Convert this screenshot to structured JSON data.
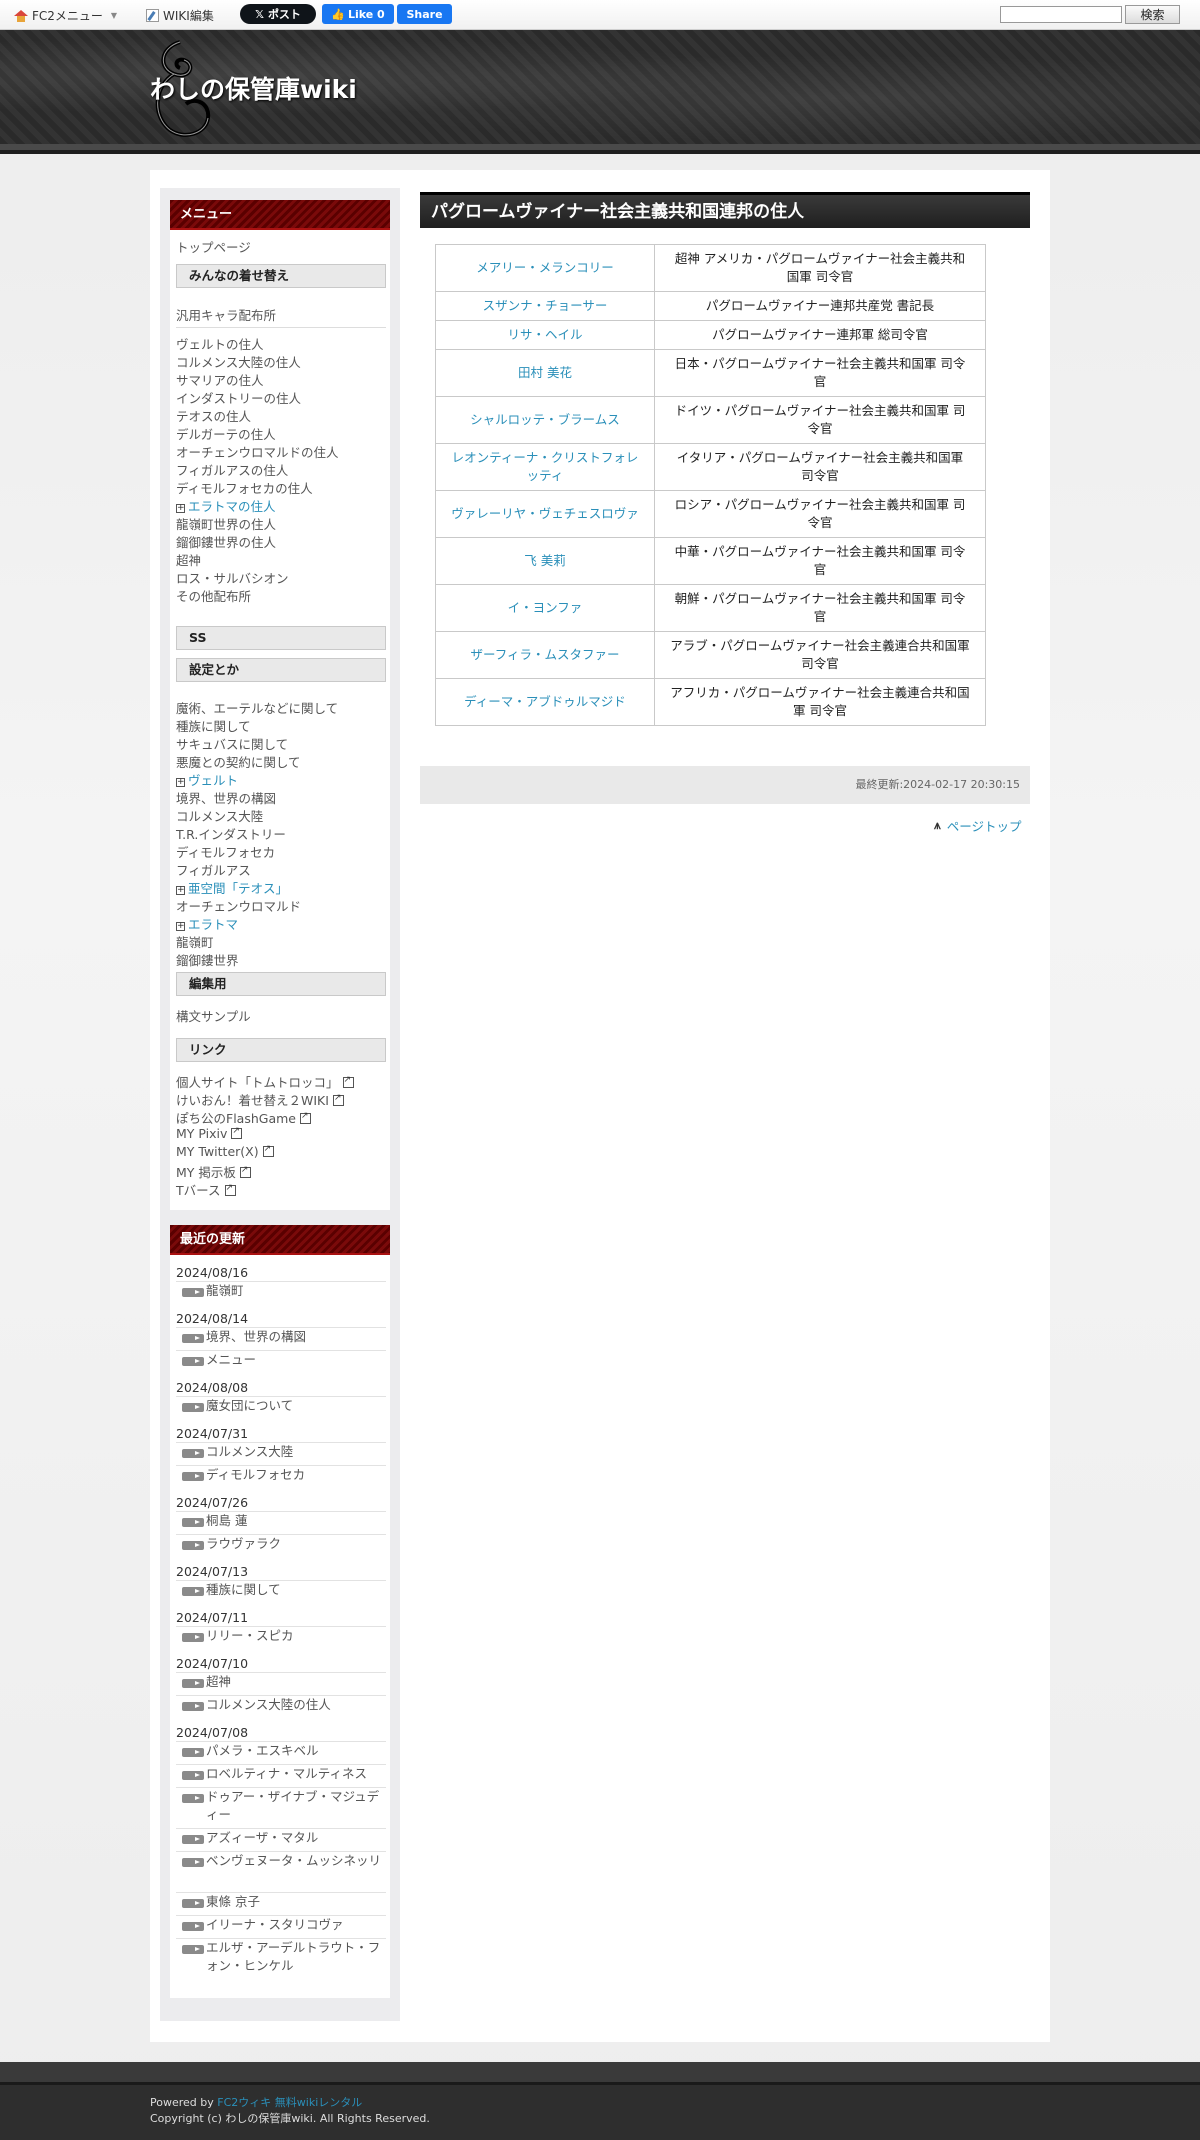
{
  "topbar": {
    "fc2_menu": "FC2メニュー",
    "wiki_edit": "WIKI編集",
    "x_post": "ポスト",
    "fb_like": "Like 0",
    "fb_share": "Share",
    "search_placeholder": "",
    "search_button": "検索"
  },
  "header": {
    "title": "わしの保管庫wiki"
  },
  "menu": {
    "heading": "メニュー",
    "top_page": "トップページ",
    "sec_kigae": "みんなの着せ替え",
    "generic_dist": "汎用キャラ配布所",
    "residents": [
      "ヴェルトの住人",
      "コルメンス大陸の住人",
      "サマリアの住人",
      "インダストリーの住人",
      "テオスの住人",
      "デルガーテの住人",
      "オーチェンウロマルドの住人",
      "フィガルアスの住人",
      "ディモルフォセカの住人"
    ],
    "eratoma_residents": "エラトマの住人",
    "residents2": [
      "龍嶺町世界の住人",
      "鎦御鏤世界の住人",
      "超神",
      "ロス・サルバシオン",
      "その他配布所"
    ],
    "sec_ss": "SS",
    "sec_settings": "設定とか",
    "settings": [
      "魔術、エーテルなどに関して",
      "種族に関して",
      "サキュバスに関して",
      "悪魔との契約に関して"
    ],
    "velt": "ヴェルト",
    "settings2": [
      "境界、世界の構図",
      "コルメンス大陸",
      "T.R.インダストリー",
      "ディモルフォセカ",
      "フィガルアス"
    ],
    "teos": "亜空間「テオス」",
    "ochen": "オーチェンウロマルド",
    "eratoma": "エラトマ",
    "settings3": [
      "龍嶺町",
      "鎦御鏤世界"
    ],
    "sec_edit": "編集用",
    "syntax_sample": "構文サンプル",
    "sec_links": "リンク",
    "links": [
      "個人サイト「トムトロッコ」",
      "けいおん！着せ替え２WIKI",
      "ぽち公のFlashGame",
      "MY Pixiv",
      "MY Twitter(X)",
      "MY 掲示板",
      "Tバース"
    ]
  },
  "recent": {
    "heading": "最近の更新",
    "groups": [
      {
        "date": "2024/08/16",
        "items": [
          "龍嶺町"
        ]
      },
      {
        "date": "2024/08/14",
        "items": [
          "境界、世界の構図",
          "メニュー"
        ]
      },
      {
        "date": "2024/08/08",
        "items": [
          "魔女団について"
        ]
      },
      {
        "date": "2024/07/31",
        "items": [
          "コルメンス大陸",
          "ディモルフォセカ"
        ]
      },
      {
        "date": "2024/07/26",
        "items": [
          "桐島 蓮",
          "ラウヴァラク"
        ]
      },
      {
        "date": "2024/07/13",
        "items": [
          "種族に関して"
        ]
      },
      {
        "date": "2024/07/11",
        "items": [
          "リリー・スピカ"
        ]
      },
      {
        "date": "2024/07/10",
        "items": [
          "超神",
          "コルメンス大陸の住人"
        ]
      },
      {
        "date": "2024/07/08",
        "items": [
          "パメラ・エスキベル",
          "ロベルティナ・マルティネス",
          "ドゥアー・ザイナブ・マジュディー",
          "アズィーザ・マタル",
          "ベンヴェヌータ・ムッシネッリ",
          "東條 京子",
          "イリーナ・スタリコヴァ",
          "エルザ・アーデルトラウト・フォン・ヒンケル"
        ]
      }
    ]
  },
  "main": {
    "title": "パグロームヴァイナー社会主義共和国連邦の住人",
    "rows": [
      {
        "name": "メアリー・メランコリー",
        "role": "超神 アメリカ・パグロームヴァイナー社会主義共和国軍 司令官"
      },
      {
        "name": "スザンナ・チョーサー",
        "role": "パグロームヴァイナー連邦共産党 書記長"
      },
      {
        "name": "リサ・ヘイル",
        "role": "パグロームヴァイナー連邦軍 総司令官"
      },
      {
        "name": "田村 美花",
        "role": "日本・パグロームヴァイナー社会主義共和国軍 司令官"
      },
      {
        "name": "シャルロッテ・ブラームス",
        "role": "ドイツ・パグロームヴァイナー社会主義共和国軍 司令官"
      },
      {
        "name": "レオンティーナ・クリストフォレッティ",
        "role": "イタリア・パグロームヴァイナー社会主義共和国軍 司令官"
      },
      {
        "name": "ヴァレーリヤ・ヴェチェスロヴァ",
        "role": "ロシア・パグロームヴァイナー社会主義共和国軍 司令官"
      },
      {
        "name": "飞 美莉",
        "role": "中華・パグロームヴァイナー社会主義共和国軍 司令官"
      },
      {
        "name": "イ・ヨンファ",
        "role": "朝鮮・パグロームヴァイナー社会主義共和国軍 司令官"
      },
      {
        "name": "ザーフィラ・ムスタファー",
        "role": "アラブ・パグロームヴァイナー社会主義連合共和国軍 司令官"
      },
      {
        "name": "ディーマ・アブドゥルマジド",
        "role": "アフリカ・パグロームヴァイナー社会主義連合共和国軍 司令官"
      }
    ],
    "last_updated": "最終更新:2024-02-17 20:30:15",
    "page_top": "ページトップ"
  },
  "footer": {
    "powered_by": "Powered by",
    "fc2wiki": "FC2ウィキ",
    "rental": "無料wikiレンタル",
    "copyright": "Copyright (c) わしの保管庫wiki. All Rights Reserved."
  }
}
